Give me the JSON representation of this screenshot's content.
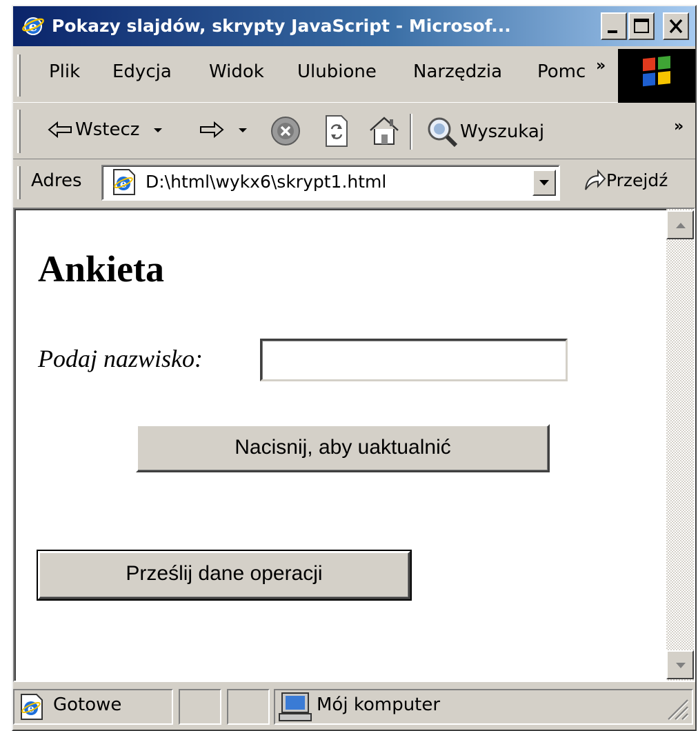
{
  "window": {
    "title": "Pokazy slajdów, skrypty JavaScript - Microsof..."
  },
  "menu": {
    "items": [
      "Plik",
      "Edycja",
      "Widok",
      "Ulubione",
      "Narzędzia",
      "Pomc"
    ],
    "overflow": "»"
  },
  "toolbar": {
    "back_label": "Wstecz",
    "search_label": "Wyszukaj",
    "overflow": "»"
  },
  "address": {
    "label": "Adres",
    "url": "D:\\html\\wykx6\\skrypt1.html",
    "go_label": "Przejdź"
  },
  "page": {
    "heading": "Ankieta",
    "name_label": "Podaj nazwisko:",
    "name_value": "",
    "update_button": "Nacisnij, aby uaktualnić",
    "submit_button": "Prześlij dane operacji"
  },
  "status": {
    "text": "Gotowe",
    "zone": "Mój komputer"
  },
  "colors": {
    "titlebar_start": "#0a246a",
    "titlebar_end": "#a6caf0",
    "chrome": "#d4d0c8"
  }
}
